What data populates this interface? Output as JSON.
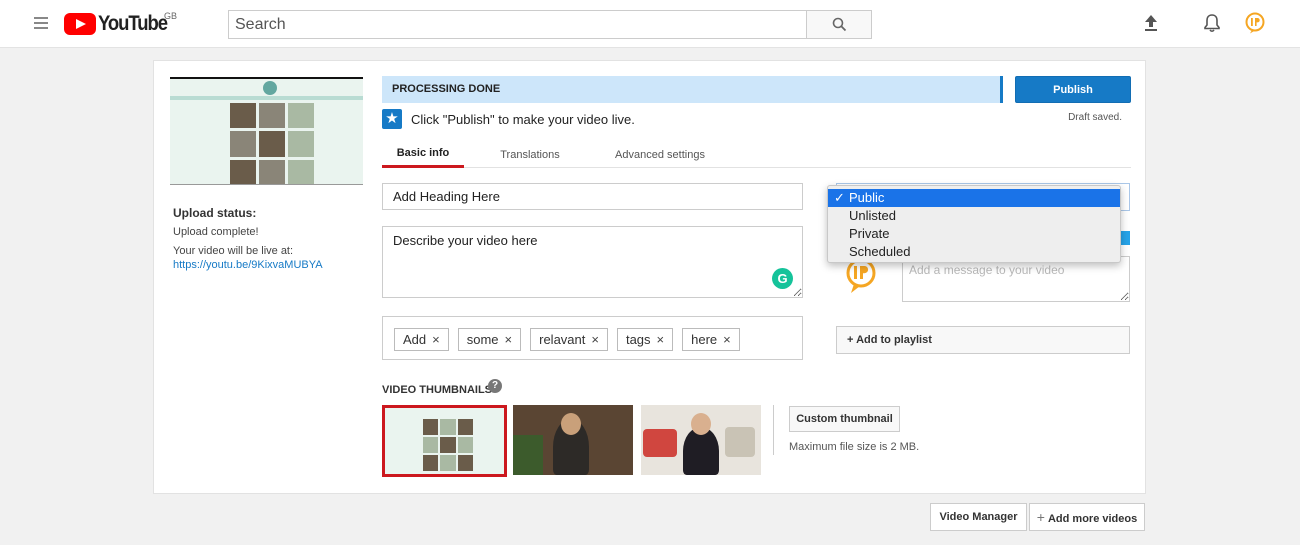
{
  "header": {
    "logo_text": "YouTube",
    "region": "GB",
    "search_placeholder": "Search"
  },
  "status": {
    "banner": "PROCESSING DONE",
    "publish_label": "Publish",
    "draft_saved": "Draft saved.",
    "hint": "Click \"Publish\" to make your video live."
  },
  "tabs": [
    {
      "label": "Basic info",
      "active": true
    },
    {
      "label": "Translations",
      "active": false
    },
    {
      "label": "Advanced settings",
      "active": false
    }
  ],
  "sidebar": {
    "upload_status_title": "Upload status:",
    "upload_complete": "Upload complete!",
    "live_at_label": "Your video will be live at:",
    "video_url": "https://youtu.be/9KixvaMUBYA"
  },
  "form": {
    "title_value": "Add Heading Here",
    "description_value": "Describe your video here",
    "tags": [
      "Add",
      "some",
      "relavant",
      "tags",
      "here"
    ],
    "tag_remove_glyph": "×",
    "message_placeholder": "Add a message to your video",
    "add_to_playlist": "+ Add to playlist"
  },
  "privacy": {
    "options": [
      "Public",
      "Unlisted",
      "Private",
      "Scheduled"
    ],
    "selected": "Public",
    "check_glyph": "✓"
  },
  "thumbnails": {
    "label": "VIDEO THUMBNAILS",
    "help_glyph": "?",
    "custom_button": "Custom thumbnail",
    "max_size": "Maximum file size is 2 MB."
  },
  "footer": {
    "video_manager": "Video Manager",
    "add_more_plus": "+",
    "add_more": "Add more videos"
  },
  "colors": {
    "brand_red": "#ff0000",
    "accent_blue": "#167ac6",
    "tab_active": "#cc181e",
    "grammarly_green": "#15c39a",
    "avatar_orange": "#f5a623"
  },
  "icons": [
    "menu-icon",
    "search-icon",
    "upload-icon",
    "bell-icon",
    "user-avatar",
    "star-icon",
    "grammarly-icon",
    "help-icon",
    "close-icon",
    "plus-icon"
  ]
}
